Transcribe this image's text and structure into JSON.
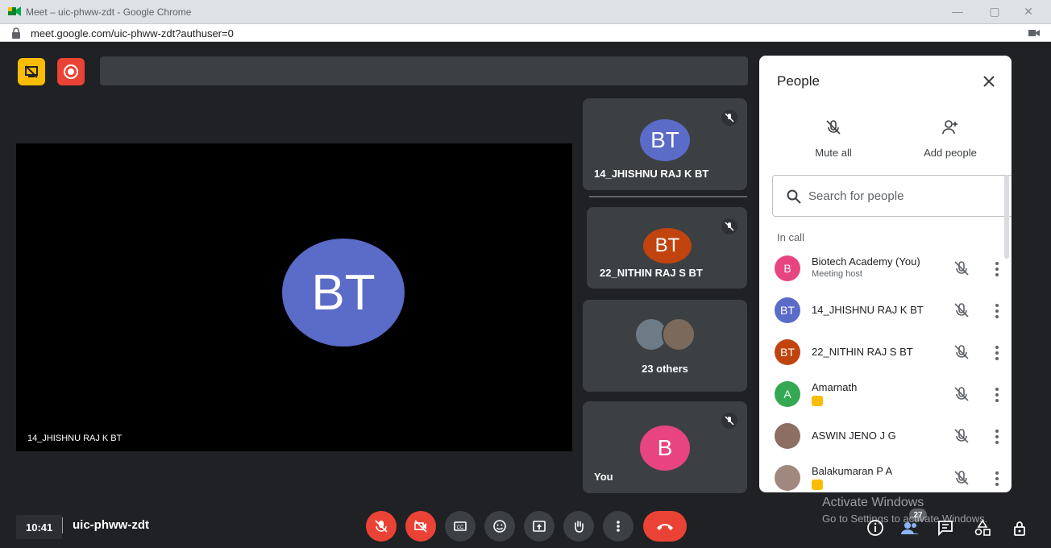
{
  "window": {
    "title": "Meet – uic-phww-zdt - Google Chrome",
    "url": "meet.google.com/uic-phww-zdt?authuser=0",
    "controls": [
      "—",
      "▢",
      "✕"
    ]
  },
  "main_video": {
    "initials": "BT",
    "name": "14_JHISHNU RAJ K BT",
    "avatar_color": "#5b6bc8"
  },
  "tiles": [
    {
      "initials": "BT",
      "name": "14_JHISHNU RAJ K BT",
      "color": "#5b6bc8"
    },
    {
      "initials": "BT",
      "name": "22_NITHIN RAJ S BT",
      "color": "#c1440e"
    },
    {
      "name": "23 others"
    },
    {
      "initials": "B",
      "name": "You",
      "color": "#e84580"
    }
  ],
  "people_panel": {
    "title": "People",
    "mute_all_label": "Mute all",
    "add_people_label": "Add people",
    "search_placeholder": "Search for people",
    "section_label": "In call",
    "participants": [
      {
        "initials": "B",
        "name": "Biotech Academy (You)",
        "sub": "Meeting host",
        "color": "#e84580"
      },
      {
        "initials": "BT",
        "name": "14_JHISHNU RAJ K BT",
        "color": "#5b6bc8"
      },
      {
        "initials": "BT",
        "name": "22_NITHIN RAJ S BT",
        "color": "#c1440e"
      },
      {
        "initials": "A",
        "name": "Amarnath",
        "color": "#34a853"
      },
      {
        "initials": "",
        "name": "ASWIN JENO J G",
        "color": "#8d6e63"
      },
      {
        "initials": "",
        "name": "Balakumaran P A",
        "color": "#a1887f"
      }
    ]
  },
  "bottom_bar": {
    "time": "10:41",
    "meeting_code": "uic-phww-zdt",
    "people_count": "27"
  },
  "watermark": {
    "line1": "Activate Windows",
    "line2": "Go to Settings to activate Windows."
  },
  "colors": {
    "background": "#202124",
    "tile": "#3c4043",
    "red": "#ea4335",
    "yellow": "#fbbc04"
  }
}
